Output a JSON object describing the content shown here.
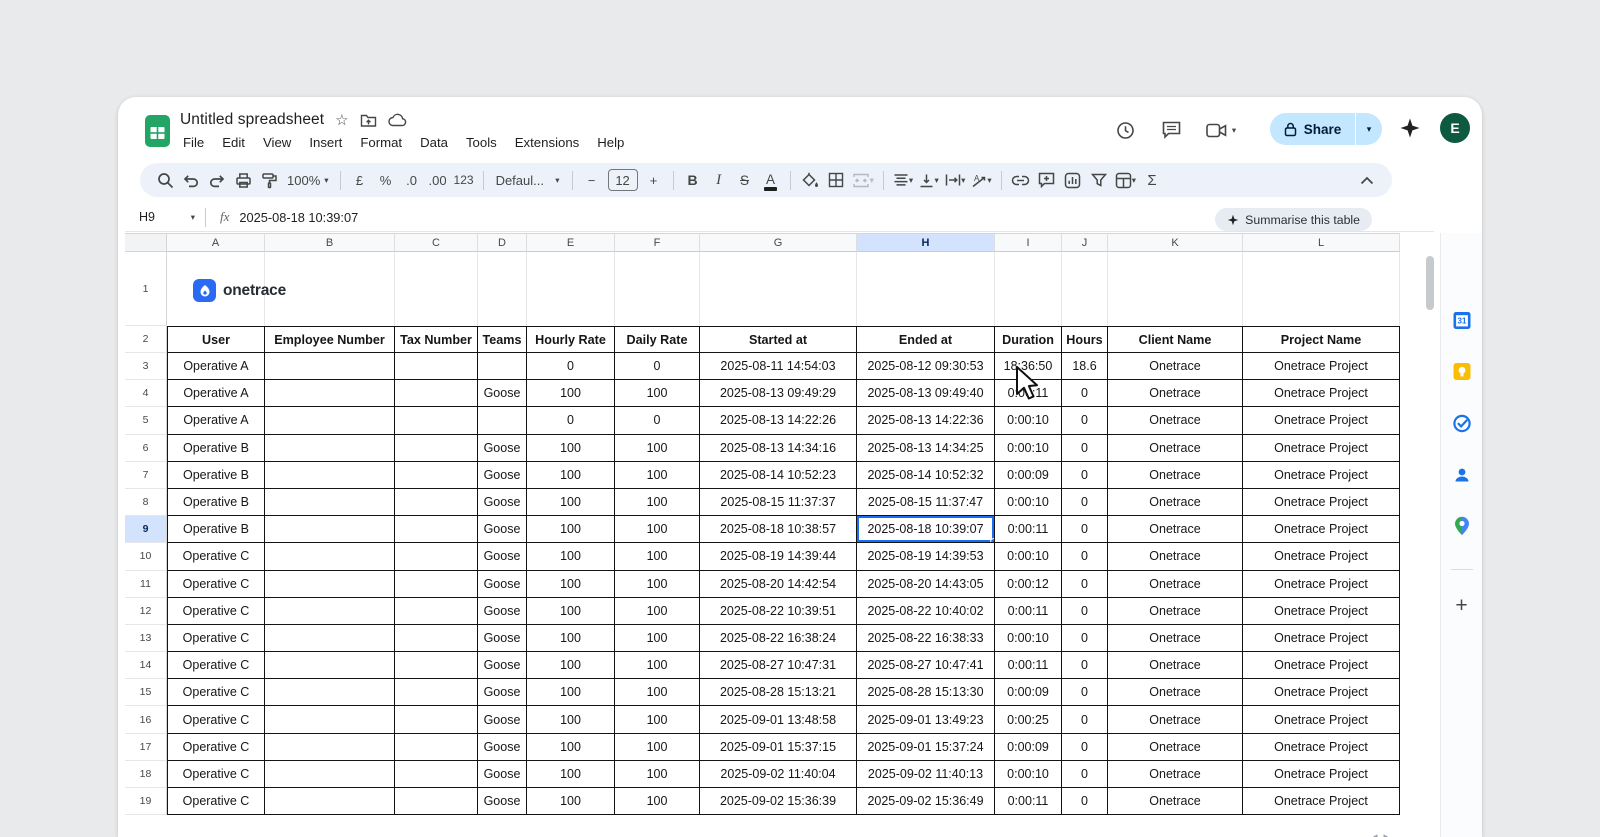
{
  "titlebar": {
    "title": "Untitled spreadsheet",
    "menus": [
      "File",
      "Edit",
      "View",
      "Insert",
      "Format",
      "Data",
      "Tools",
      "Extensions",
      "Help"
    ],
    "share_label": "Share",
    "avatar_initial": "E"
  },
  "toolbar": {
    "zoom": "100%",
    "currency": "£",
    "percent": "%",
    "decrease_decimal": ".0",
    "increase_decimal": ".00",
    "more_formats": "123",
    "font": "Defaul...",
    "font_size": "12",
    "minus": "−",
    "plus": "+",
    "bold": "B",
    "italic": "I",
    "strikethrough": "S",
    "text_color": "A",
    "functions": "Σ"
  },
  "formula_bar": {
    "name_box": "H9",
    "fx": "fx",
    "value": "2025-08-18 10:39:07",
    "summarise_label": "Summarise this table"
  },
  "sheet": {
    "logo_text": "onetrace",
    "column_letters": [
      "A",
      "B",
      "C",
      "D",
      "E",
      "F",
      "G",
      "H",
      "I",
      "J",
      "K",
      "L"
    ],
    "selected_column": "H",
    "selected_row": "9",
    "selected_cell": "H9",
    "logo_row_number": "1",
    "header_row_number": "2",
    "columns": [
      "User",
      "Employee Number",
      "Tax Number",
      "Teams",
      "Hourly Rate",
      "Daily Rate",
      "Started at",
      "Ended at",
      "Duration",
      "Hours",
      "Client Name",
      "Project Name"
    ],
    "rows": [
      {
        "n": "3",
        "user": "Operative A",
        "employee": "",
        "tax": "",
        "team": "",
        "hourly": "0",
        "daily": "0",
        "started": "2025-08-11 14:54:03",
        "ended": "2025-08-12 09:30:53",
        "duration": "18:36:50",
        "hours": "18.6",
        "client": "Onetrace",
        "project": "Onetrace Project"
      },
      {
        "n": "4",
        "user": "Operative A",
        "employee": "",
        "tax": "",
        "team": "Goose",
        "hourly": "100",
        "daily": "100",
        "started": "2025-08-13 09:49:29",
        "ended": "2025-08-13 09:49:40",
        "duration": "0:00:11",
        "hours": "0",
        "client": "Onetrace",
        "project": "Onetrace Project"
      },
      {
        "n": "5",
        "user": "Operative A",
        "employee": "",
        "tax": "",
        "team": "",
        "hourly": "0",
        "daily": "0",
        "started": "2025-08-13 14:22:26",
        "ended": "2025-08-13 14:22:36",
        "duration": "0:00:10",
        "hours": "0",
        "client": "Onetrace",
        "project": "Onetrace Project"
      },
      {
        "n": "6",
        "user": "Operative B",
        "employee": "",
        "tax": "",
        "team": "Goose",
        "hourly": "100",
        "daily": "100",
        "started": "2025-08-13 14:34:16",
        "ended": "2025-08-13 14:34:25",
        "duration": "0:00:10",
        "hours": "0",
        "client": "Onetrace",
        "project": "Onetrace Project"
      },
      {
        "n": "7",
        "user": "Operative B",
        "employee": "",
        "tax": "",
        "team": "Goose",
        "hourly": "100",
        "daily": "100",
        "started": "2025-08-14 10:52:23",
        "ended": "2025-08-14 10:52:32",
        "duration": "0:00:09",
        "hours": "0",
        "client": "Onetrace",
        "project": "Onetrace Project"
      },
      {
        "n": "8",
        "user": "Operative B",
        "employee": "",
        "tax": "",
        "team": "Goose",
        "hourly": "100",
        "daily": "100",
        "started": "2025-08-15 11:37:37",
        "ended": "2025-08-15 11:37:47",
        "duration": "0:00:10",
        "hours": "0",
        "client": "Onetrace",
        "project": "Onetrace Project"
      },
      {
        "n": "9",
        "user": "Operative B",
        "employee": "",
        "tax": "",
        "team": "Goose",
        "hourly": "100",
        "daily": "100",
        "started": "2025-08-18 10:38:57",
        "ended": "2025-08-18 10:39:07",
        "duration": "0:00:11",
        "hours": "0",
        "client": "Onetrace",
        "project": "Onetrace Project"
      },
      {
        "n": "10",
        "user": "Operative C",
        "employee": "",
        "tax": "",
        "team": "Goose",
        "hourly": "100",
        "daily": "100",
        "started": "2025-08-19 14:39:44",
        "ended": "2025-08-19 14:39:53",
        "duration": "0:00:10",
        "hours": "0",
        "client": "Onetrace",
        "project": "Onetrace Project"
      },
      {
        "n": "11",
        "user": "Operative C",
        "employee": "",
        "tax": "",
        "team": "Goose",
        "hourly": "100",
        "daily": "100",
        "started": "2025-08-20 14:42:54",
        "ended": "2025-08-20 14:43:05",
        "duration": "0:00:12",
        "hours": "0",
        "client": "Onetrace",
        "project": "Onetrace Project"
      },
      {
        "n": "12",
        "user": "Operative C",
        "employee": "",
        "tax": "",
        "team": "Goose",
        "hourly": "100",
        "daily": "100",
        "started": "2025-08-22 10:39:51",
        "ended": "2025-08-22 10:40:02",
        "duration": "0:00:11",
        "hours": "0",
        "client": "Onetrace",
        "project": "Onetrace Project"
      },
      {
        "n": "13",
        "user": "Operative C",
        "employee": "",
        "tax": "",
        "team": "Goose",
        "hourly": "100",
        "daily": "100",
        "started": "2025-08-22 16:38:24",
        "ended": "2025-08-22 16:38:33",
        "duration": "0:00:10",
        "hours": "0",
        "client": "Onetrace",
        "project": "Onetrace Project"
      },
      {
        "n": "14",
        "user": "Operative C",
        "employee": "",
        "tax": "",
        "team": "Goose",
        "hourly": "100",
        "daily": "100",
        "started": "2025-08-27 10:47:31",
        "ended": "2025-08-27 10:47:41",
        "duration": "0:00:11",
        "hours": "0",
        "client": "Onetrace",
        "project": "Onetrace Project"
      },
      {
        "n": "15",
        "user": "Operative C",
        "employee": "",
        "tax": "",
        "team": "Goose",
        "hourly": "100",
        "daily": "100",
        "started": "2025-08-28 15:13:21",
        "ended": "2025-08-28 15:13:30",
        "duration": "0:00:09",
        "hours": "0",
        "client": "Onetrace",
        "project": "Onetrace Project"
      },
      {
        "n": "16",
        "user": "Operative C",
        "employee": "",
        "tax": "",
        "team": "Goose",
        "hourly": "100",
        "daily": "100",
        "started": "2025-09-01 13:48:58",
        "ended": "2025-09-01 13:49:23",
        "duration": "0:00:25",
        "hours": "0",
        "client": "Onetrace",
        "project": "Onetrace Project"
      },
      {
        "n": "17",
        "user": "Operative C",
        "employee": "",
        "tax": "",
        "team": "Goose",
        "hourly": "100",
        "daily": "100",
        "started": "2025-09-01 15:37:15",
        "ended": "2025-09-01 15:37:24",
        "duration": "0:00:09",
        "hours": "0",
        "client": "Onetrace",
        "project": "Onetrace Project"
      },
      {
        "n": "18",
        "user": "Operative C",
        "employee": "",
        "tax": "",
        "team": "Goose",
        "hourly": "100",
        "daily": "100",
        "started": "2025-09-02 11:40:04",
        "ended": "2025-09-02 11:40:13",
        "duration": "0:00:10",
        "hours": "0",
        "client": "Onetrace",
        "project": "Onetrace Project"
      },
      {
        "n": "19",
        "user": "Operative C",
        "employee": "",
        "tax": "",
        "team": "Goose",
        "hourly": "100",
        "daily": "100",
        "started": "2025-09-02 15:36:39",
        "ended": "2025-09-02 15:36:49",
        "duration": "0:00:11",
        "hours": "0",
        "client": "Onetrace",
        "project": "Onetrace Project"
      }
    ]
  },
  "side_panel": {
    "icons": [
      "calendar",
      "keep",
      "tasks",
      "contacts",
      "maps",
      "add"
    ],
    "calendar_day": "31"
  },
  "colors": {
    "accent": "#1b6ef3",
    "selection_fill": "#d3e3fd",
    "share_bg": "#c2e7ff",
    "avatar_bg": "#0e5a40",
    "toolbar_bg": "#edf2fa",
    "sheets_green": "#23a566",
    "onetrace_blue": "#2b6bf3"
  }
}
